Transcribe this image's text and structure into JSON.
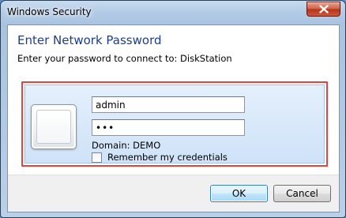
{
  "window": {
    "title": "Windows Security",
    "close_icon": "close-x"
  },
  "dialog": {
    "heading": "Enter Network Password",
    "subheading": "Enter your password to connect to: DiskStation"
  },
  "credential": {
    "username_value": "admin",
    "password_value": "•••",
    "domain_text": "Domain: DEMO",
    "remember_label": "Remember my credentials",
    "remember_checked": false,
    "user_icon": "user-tile-icon"
  },
  "buttons": {
    "ok_label": "OK",
    "cancel_label": "Cancel"
  },
  "colors": {
    "heading": "#1c3d8f",
    "highlight_border": "#e3423f",
    "close_button": "#c74a30"
  }
}
